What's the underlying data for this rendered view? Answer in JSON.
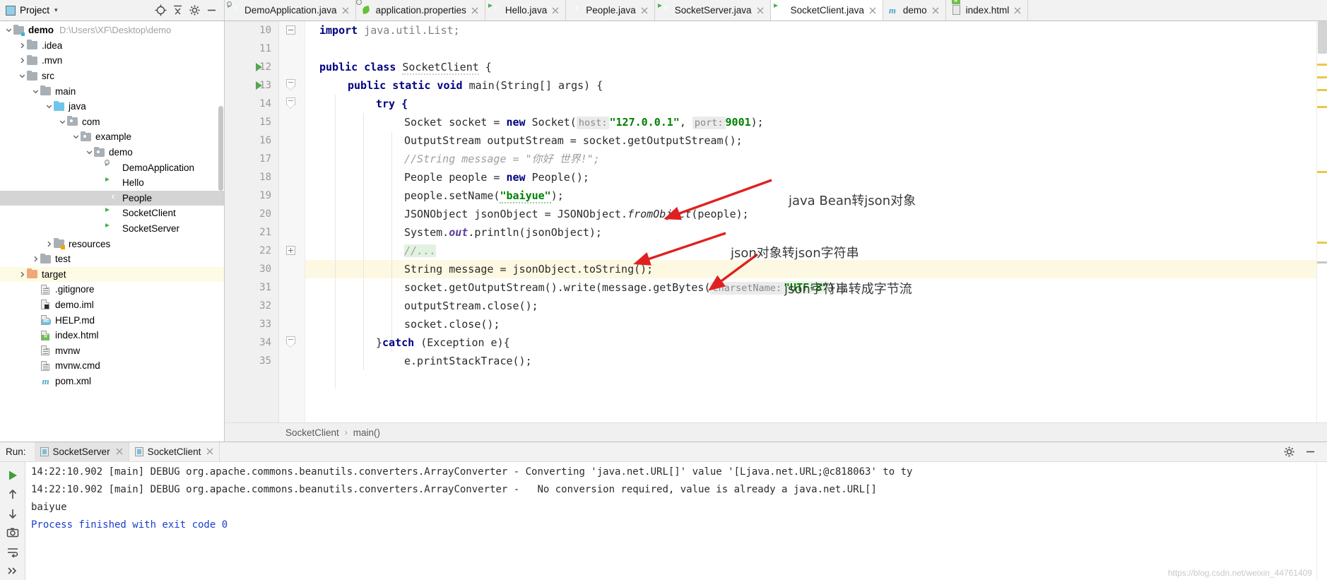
{
  "window": {
    "project_panel_title": "Project",
    "project_caret": "▾"
  },
  "toolbar": {
    "locate_icon": "crosshair-icon",
    "collapse_icon": "collapse-all-icon",
    "settings_icon": "gear-icon",
    "hide_icon": "minimize-icon"
  },
  "project_tree": [
    {
      "depth": 0,
      "arrow": "down",
      "icon": "module-folder",
      "label": "demo",
      "bold": true,
      "path": "D:\\Users\\XF\\Desktop\\demo",
      "state": "normal"
    },
    {
      "depth": 1,
      "arrow": "right",
      "icon": "folder",
      "label": ".idea",
      "state": "normal"
    },
    {
      "depth": 1,
      "arrow": "right",
      "icon": "folder",
      "label": ".mvn",
      "state": "normal"
    },
    {
      "depth": 1,
      "arrow": "down",
      "icon": "folder",
      "label": "src",
      "state": "normal"
    },
    {
      "depth": 2,
      "arrow": "down",
      "icon": "folder",
      "label": "main",
      "state": "normal"
    },
    {
      "depth": 3,
      "arrow": "down",
      "icon": "source-folder",
      "label": "java",
      "state": "normal"
    },
    {
      "depth": 4,
      "arrow": "down",
      "icon": "package",
      "label": "com",
      "state": "normal"
    },
    {
      "depth": 5,
      "arrow": "down",
      "icon": "package",
      "label": "example",
      "state": "normal"
    },
    {
      "depth": 6,
      "arrow": "down",
      "icon": "package",
      "label": "demo",
      "state": "normal"
    },
    {
      "depth": 7,
      "arrow": "none",
      "icon": "java-app-class",
      "label": "DemoApplication",
      "state": "normal"
    },
    {
      "depth": 7,
      "arrow": "none",
      "icon": "java-run-class",
      "label": "Hello",
      "state": "normal"
    },
    {
      "depth": 7,
      "arrow": "none",
      "icon": "java-class",
      "label": "People",
      "state": "selected"
    },
    {
      "depth": 7,
      "arrow": "none",
      "icon": "java-run-class",
      "label": "SocketClient",
      "state": "normal"
    },
    {
      "depth": 7,
      "arrow": "none",
      "icon": "java-run-class",
      "label": "SocketServer",
      "state": "normal"
    },
    {
      "depth": 3,
      "arrow": "right",
      "icon": "resource-folder",
      "label": "resources",
      "state": "normal"
    },
    {
      "depth": 2,
      "arrow": "right",
      "icon": "folder",
      "label": "test",
      "state": "normal"
    },
    {
      "depth": 1,
      "arrow": "right",
      "icon": "excluded-folder",
      "label": "target",
      "state": "highlight"
    },
    {
      "depth": 2,
      "arrow": "none",
      "icon": "file",
      "label": ".gitignore",
      "state": "normal"
    },
    {
      "depth": 2,
      "arrow": "none",
      "icon": "iml-file",
      "label": "demo.iml",
      "state": "normal"
    },
    {
      "depth": 2,
      "arrow": "none",
      "icon": "md-file",
      "label": "HELP.md",
      "state": "normal"
    },
    {
      "depth": 2,
      "arrow": "none",
      "icon": "html-file",
      "label": "index.html",
      "state": "normal"
    },
    {
      "depth": 2,
      "arrow": "none",
      "icon": "file",
      "label": "mvnw",
      "state": "normal"
    },
    {
      "depth": 2,
      "arrow": "none",
      "icon": "file",
      "label": "mvnw.cmd",
      "state": "normal"
    },
    {
      "depth": 2,
      "arrow": "none",
      "icon": "maven-file",
      "label": "pom.xml",
      "state": "normal"
    }
  ],
  "editor_tabs": [
    {
      "label": "DemoApplication.java",
      "icon": "java-app-class",
      "active": false
    },
    {
      "label": "application.properties",
      "icon": "properties-file",
      "active": false
    },
    {
      "label": "Hello.java",
      "icon": "java-run-class",
      "active": false
    },
    {
      "label": "People.java",
      "icon": "java-class",
      "active": false
    },
    {
      "label": "SocketServer.java",
      "icon": "java-run-class",
      "active": false
    },
    {
      "label": "SocketClient.java",
      "icon": "java-run-class",
      "active": true
    },
    {
      "label": "demo",
      "icon": "maven-file",
      "active": false
    },
    {
      "label": "index.html",
      "icon": "html-file",
      "active": false
    }
  ],
  "editor": {
    "file": "SocketClient.java",
    "line_numbers": [
      "10",
      "11",
      "12",
      "13",
      "14",
      "15",
      "16",
      "17",
      "18",
      "19",
      "20",
      "21",
      "22",
      "30",
      "31",
      "32",
      "33",
      "34",
      "35"
    ],
    "highlighted_line": "30",
    "code": {
      "l10": "import java.util.List;",
      "l11": "",
      "l12_a": "public class ",
      "l12_b": "SocketClient",
      "l12_c": " {",
      "l13_a": "public static void ",
      "l13_b": "main(String[] args) {",
      "l14": "try {",
      "l15_a": "Socket socket = ",
      "l15_b": "new",
      "l15_c": " Socket(",
      "l15_hint1": "host:",
      "l15_str1": "\"127.0.0.1\"",
      "l15_d": ", ",
      "l15_hint2": "port:",
      "l15_num": "9001",
      "l15_e": ");",
      "l16": "OutputStream outputStream = socket.getOutputStream();",
      "l17": "//String message = \"你好 世界!\";",
      "l18_a": "People people = ",
      "l18_b": "new",
      "l18_c": " People();",
      "l19_a": "people.setName(",
      "l19_b": "\"baiyue\"",
      "l19_c": ");",
      "l20_a": "JSONObject jsonObject = JSONObject.",
      "l20_b": "fromObject",
      "l20_c": "(people);",
      "l21_a": "System.",
      "l21_b": "out",
      "l21_c": ".println(jsonObject);",
      "l22": "//...",
      "l30": "String message = jsonObject.toString();",
      "l31_a": "socket.getOutputStream().write(message.getBytes(",
      "l31_hint": "charsetName:",
      "l31_str": "\"UTF-8\"",
      "l31_b": "));",
      "l32": "outputStream.close();",
      "l33": "socket.close();",
      "l34_a": "}",
      "l34_b": "catch",
      "l34_c": " (Exception e){",
      "l35": "e.printStackTrace();"
    },
    "annotations": [
      {
        "text": "java Bean转json对象",
        "color": "#e02020"
      },
      {
        "text": "json对象转json字符串",
        "color": "#e02020"
      },
      {
        "text": "json字符串转成字节流",
        "color": "#e02020"
      }
    ],
    "breadcrumb": {
      "class": "SocketClient",
      "separator": "›",
      "method": "main()"
    }
  },
  "run_panel": {
    "title": "Run:",
    "tabs": [
      {
        "label": "SocketServer",
        "active": true
      },
      {
        "label": "SocketClient",
        "active": false
      }
    ],
    "tools": [
      "run-icon",
      "arrow-up-icon",
      "arrow-down-icon",
      "camera-icon",
      "wrap-text-icon",
      "more-icon"
    ],
    "settings_icon": "gear-icon",
    "minimize_icon": "minimize-icon",
    "console_lines": [
      "14:22:10.902 [main] DEBUG org.apache.commons.beanutils.converters.ArrayConverter - Converting 'java.net.URL[]' value '[Ljava.net.URL;@c818063' to ty",
      "14:22:10.902 [main] DEBUG org.apache.commons.beanutils.converters.ArrayConverter -   No conversion required, value is already a java.net.URL[]",
      "baiyue",
      "Process finished with exit code 0"
    ],
    "watermark": "https://blog.csdn.net/weixin_44761409"
  },
  "colors": {
    "keyword": "#000080",
    "string": "#008000",
    "comment": "#9e9e9e",
    "annotation_arrow": "#e02020",
    "highlight_row": "#fdf8e2",
    "selection": "#d4d4d4"
  }
}
